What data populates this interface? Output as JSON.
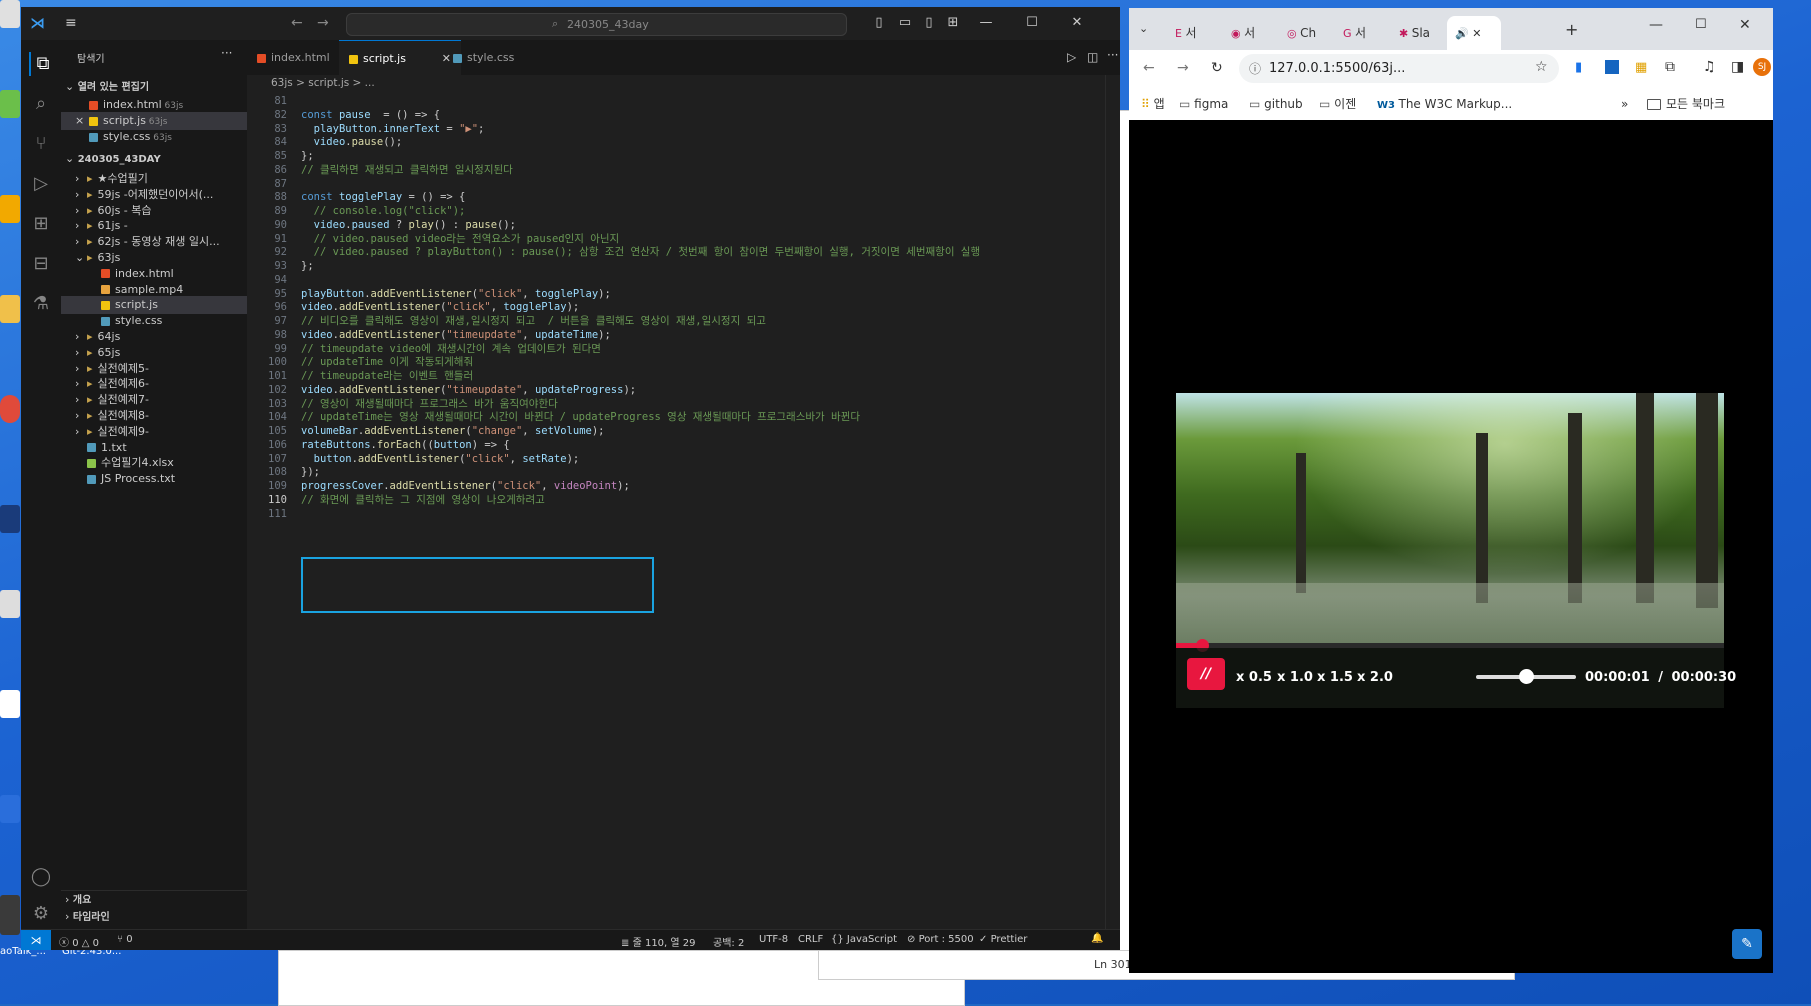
{
  "vscode": {
    "search_text": "240305_43day",
    "sidebar": {
      "title": "탐색기",
      "open_editors_header": "열려 있는 편집기",
      "open_editors": [
        {
          "name": "index.html",
          "hint": "63js",
          "type": "html",
          "close": ""
        },
        {
          "name": "script.js",
          "hint": "63js",
          "type": "js",
          "close": "×"
        },
        {
          "name": "style.css",
          "hint": "63js",
          "type": "css",
          "close": ""
        }
      ],
      "project_header": "240305_43DAY",
      "tree": [
        {
          "name": "★수업필기",
          "type": "folder",
          "open": false,
          "indent": 1
        },
        {
          "name": "59js -어제했던이어서(...",
          "type": "folder",
          "open": false,
          "indent": 1
        },
        {
          "name": "60js - 복습",
          "type": "folder",
          "open": false,
          "indent": 1
        },
        {
          "name": "61js -",
          "type": "folder",
          "open": false,
          "indent": 1
        },
        {
          "name": "62js - 동영상 재생 일시...",
          "type": "folder",
          "open": false,
          "indent": 1
        },
        {
          "name": "63js",
          "type": "folder",
          "open": true,
          "indent": 1
        },
        {
          "name": "index.html",
          "type": "html",
          "indent": 2
        },
        {
          "name": "sample.mp4",
          "type": "mp4",
          "indent": 2
        },
        {
          "name": "script.js",
          "type": "js",
          "indent": 2,
          "selected": true
        },
        {
          "name": "style.css",
          "type": "css",
          "indent": 2
        },
        {
          "name": "64js",
          "type": "folder",
          "open": false,
          "indent": 1
        },
        {
          "name": "65js",
          "type": "folder",
          "open": false,
          "indent": 1
        },
        {
          "name": "실전예제5-",
          "type": "folder",
          "open": false,
          "indent": 1
        },
        {
          "name": "실전예제6-",
          "type": "folder",
          "open": false,
          "indent": 1
        },
        {
          "name": "실전예제7-",
          "type": "folder",
          "open": false,
          "indent": 1
        },
        {
          "name": "실전예제8-",
          "type": "folder",
          "open": false,
          "indent": 1
        },
        {
          "name": "실전예제9-",
          "type": "folder",
          "open": false,
          "indent": 1
        },
        {
          "name": "1.txt",
          "type": "txt",
          "indent": 1
        },
        {
          "name": "수업필기4.xlsx",
          "type": "xlsx",
          "indent": 1
        },
        {
          "name": "JS Process.txt",
          "type": "txt",
          "indent": 1
        }
      ],
      "outline": "개요",
      "timeline": "타임라인"
    },
    "tabs": [
      {
        "label": "index.html",
        "type": "html",
        "active": false
      },
      {
        "label": "script.js",
        "type": "js",
        "active": true
      },
      {
        "label": "style.css",
        "type": "css",
        "active": false
      }
    ],
    "breadcrumb": "63js  >  script.js  > ...",
    "first_line": 81,
    "current_line": 110,
    "code_lines": [
      [],
      [
        [
          "kw",
          "const "
        ],
        [
          "var",
          "pause"
        ],
        [
          "",
          "  = () => {"
        ]
      ],
      [
        [
          "",
          "  "
        ],
        [
          "var",
          "playButton"
        ],
        [
          "",
          "."
        ],
        [
          "var",
          "innerText"
        ],
        [
          "",
          " = "
        ],
        [
          "str",
          "\"▶\""
        ],
        [
          "",
          ";"
        ]
      ],
      [
        [
          "",
          "  "
        ],
        [
          "var",
          "video"
        ],
        [
          "",
          "."
        ],
        [
          "fn",
          "pause"
        ],
        [
          "",
          "();"
        ]
      ],
      [
        [
          "",
          "};"
        ]
      ],
      [
        [
          "cm",
          "// 클릭하면 재생되고 클릭하면 일시정지된다"
        ]
      ],
      [],
      [
        [
          "kw",
          "const "
        ],
        [
          "var",
          "togglePlay"
        ],
        [
          "",
          " = () => {"
        ]
      ],
      [
        [
          "",
          "  "
        ],
        [
          "cm",
          "// console.log(\"click\");"
        ]
      ],
      [
        [
          "",
          "  "
        ],
        [
          "var",
          "video"
        ],
        [
          "",
          "."
        ],
        [
          "var",
          "paused"
        ],
        [
          "",
          " ? "
        ],
        [
          "fn",
          "play"
        ],
        [
          "",
          "() : "
        ],
        [
          "fn",
          "pause"
        ],
        [
          "",
          "();"
        ]
      ],
      [
        [
          "",
          "  "
        ],
        [
          "cm",
          "// video.paused video라는 전역요소가 paused인지 아닌지"
        ]
      ],
      [
        [
          "",
          "  "
        ],
        [
          "cm",
          "// video.paused ? playButton() : pause(); 삼항 조건 연산자 / 첫번째 항이 참이면 두번째항이 실행, 거짓이면 세번째항이 실행"
        ]
      ],
      [
        [
          "",
          "};"
        ]
      ],
      [],
      [
        [
          "var",
          "playButton"
        ],
        [
          "",
          "."
        ],
        [
          "fn",
          "addEventListener"
        ],
        [
          "",
          "("
        ],
        [
          "str",
          "\"click\""
        ],
        [
          "",
          ", "
        ],
        [
          "var",
          "togglePlay"
        ],
        [
          "",
          ");"
        ]
      ],
      [
        [
          "var",
          "video"
        ],
        [
          "",
          "."
        ],
        [
          "fn",
          "addEventListener"
        ],
        [
          "",
          "("
        ],
        [
          "str",
          "\"click\""
        ],
        [
          "",
          ", "
        ],
        [
          "var",
          "togglePlay"
        ],
        [
          "",
          ");"
        ]
      ],
      [
        [
          "cm",
          "// 비디오를 클릭해도 영상이 재생,일시정지 되고  / 버튼을 클릭해도 영상이 재생,일시정지 되고"
        ]
      ],
      [
        [
          "var",
          "video"
        ],
        [
          "",
          "."
        ],
        [
          "fn",
          "addEventListener"
        ],
        [
          "",
          "("
        ],
        [
          "str",
          "\"timeupdate\""
        ],
        [
          "",
          ", "
        ],
        [
          "var",
          "updateTime"
        ],
        [
          "",
          ");"
        ]
      ],
      [
        [
          "cm",
          "// timeupdate video에 재생시간이 계속 업데이트가 된다면"
        ]
      ],
      [
        [
          "cm",
          "// updateTime 이게 작동되게해줘"
        ]
      ],
      [
        [
          "cm",
          "// timeupdate라는 이벤트 핸들러"
        ]
      ],
      [
        [
          "var",
          "video"
        ],
        [
          "",
          "."
        ],
        [
          "fn",
          "addEventListener"
        ],
        [
          "",
          "("
        ],
        [
          "str",
          "\"timeupdate\""
        ],
        [
          "",
          ", "
        ],
        [
          "var",
          "updateProgress"
        ],
        [
          "",
          ");"
        ]
      ],
      [
        [
          "cm",
          "// 영상이 재생될때마다 프로그래스 바가 움직여야한다"
        ]
      ],
      [
        [
          "cm",
          "// updateTime는 영상 재생될때마다 시간이 바뀐다 / updateProgress 영상 재생될때마다 프로그래스바가 바뀐다"
        ]
      ],
      [
        [
          "var",
          "volumeBar"
        ],
        [
          "",
          "."
        ],
        [
          "fn",
          "addEventListener"
        ],
        [
          "",
          "("
        ],
        [
          "str",
          "\"change\""
        ],
        [
          "",
          ", "
        ],
        [
          "var",
          "setVolume"
        ],
        [
          "",
          ");"
        ]
      ],
      [
        [
          "var",
          "rateButtons"
        ],
        [
          "",
          "."
        ],
        [
          "fn",
          "forEach"
        ],
        [
          "",
          "(("
        ],
        [
          "var",
          "button"
        ],
        [
          "",
          ") => {"
        ]
      ],
      [
        [
          "",
          "  "
        ],
        [
          "var",
          "button"
        ],
        [
          "",
          "."
        ],
        [
          "fn",
          "addEventListener"
        ],
        [
          "",
          "("
        ],
        [
          "str",
          "\"click\""
        ],
        [
          "",
          ", "
        ],
        [
          "var",
          "setRate"
        ],
        [
          "",
          ");"
        ]
      ],
      [
        [
          "",
          "});"
        ]
      ],
      [
        [
          "var",
          "progressCover"
        ],
        [
          "",
          "."
        ],
        [
          "fn",
          "addEventListener"
        ],
        [
          "",
          "("
        ],
        [
          "str",
          "\"click\""
        ],
        [
          "",
          ", "
        ],
        [
          "ctl",
          "videoPoint"
        ],
        [
          "",
          ");"
        ]
      ],
      [
        [
          "cm",
          "// 화면에 클릭하는 그 지점에 영상이 나오게하려고"
        ]
      ],
      []
    ],
    "status": {
      "errors": "0",
      "warnings": "0",
      "ports": "0",
      "position": "줄 110, 열 29",
      "spaces": "공백: 2",
      "encoding": "UTF-8",
      "eol": "CRLF",
      "language": "JavaScript",
      "port": "Port : 5500",
      "formatter": "Prettier"
    }
  },
  "chrome": {
    "tabs": [
      {
        "label": "서",
        "icon": "E"
      },
      {
        "label": "서",
        "icon": "◉"
      },
      {
        "label": "Ch",
        "icon": "◎"
      },
      {
        "label": "서",
        "icon": "G"
      },
      {
        "label": "Sla",
        "icon": "✱"
      },
      {
        "label": "",
        "icon": "🔊",
        "active": true
      }
    ],
    "url": "127.0.0.1:5500/63j...",
    "bookmarks": [
      {
        "label": "앱",
        "icon": "apps"
      },
      {
        "label": "figma",
        "icon": "folder"
      },
      {
        "label": "github",
        "icon": "folder"
      },
      {
        "label": "이젠",
        "icon": "folder"
      },
      {
        "label": "The W3C Markup...",
        "icon": "w3c"
      }
    ],
    "all_bookmarks": "모든 북마크",
    "profile": "SJ",
    "player": {
      "pause_label": "//",
      "rates": [
        "x 0.5",
        "x 1.0",
        "x 1.5",
        "x 2.0"
      ],
      "current_time": "00:00:01",
      "separator": "/",
      "duration": "00:00:30",
      "volume_level": 0.5,
      "progress": 0.04,
      "accent": "#e8173f"
    }
  },
  "desktop": {
    "behind_window_text": "Ln 301",
    "taskbar_labels": [
      "aoTalk_...",
      "Git-2.43.0..."
    ]
  }
}
